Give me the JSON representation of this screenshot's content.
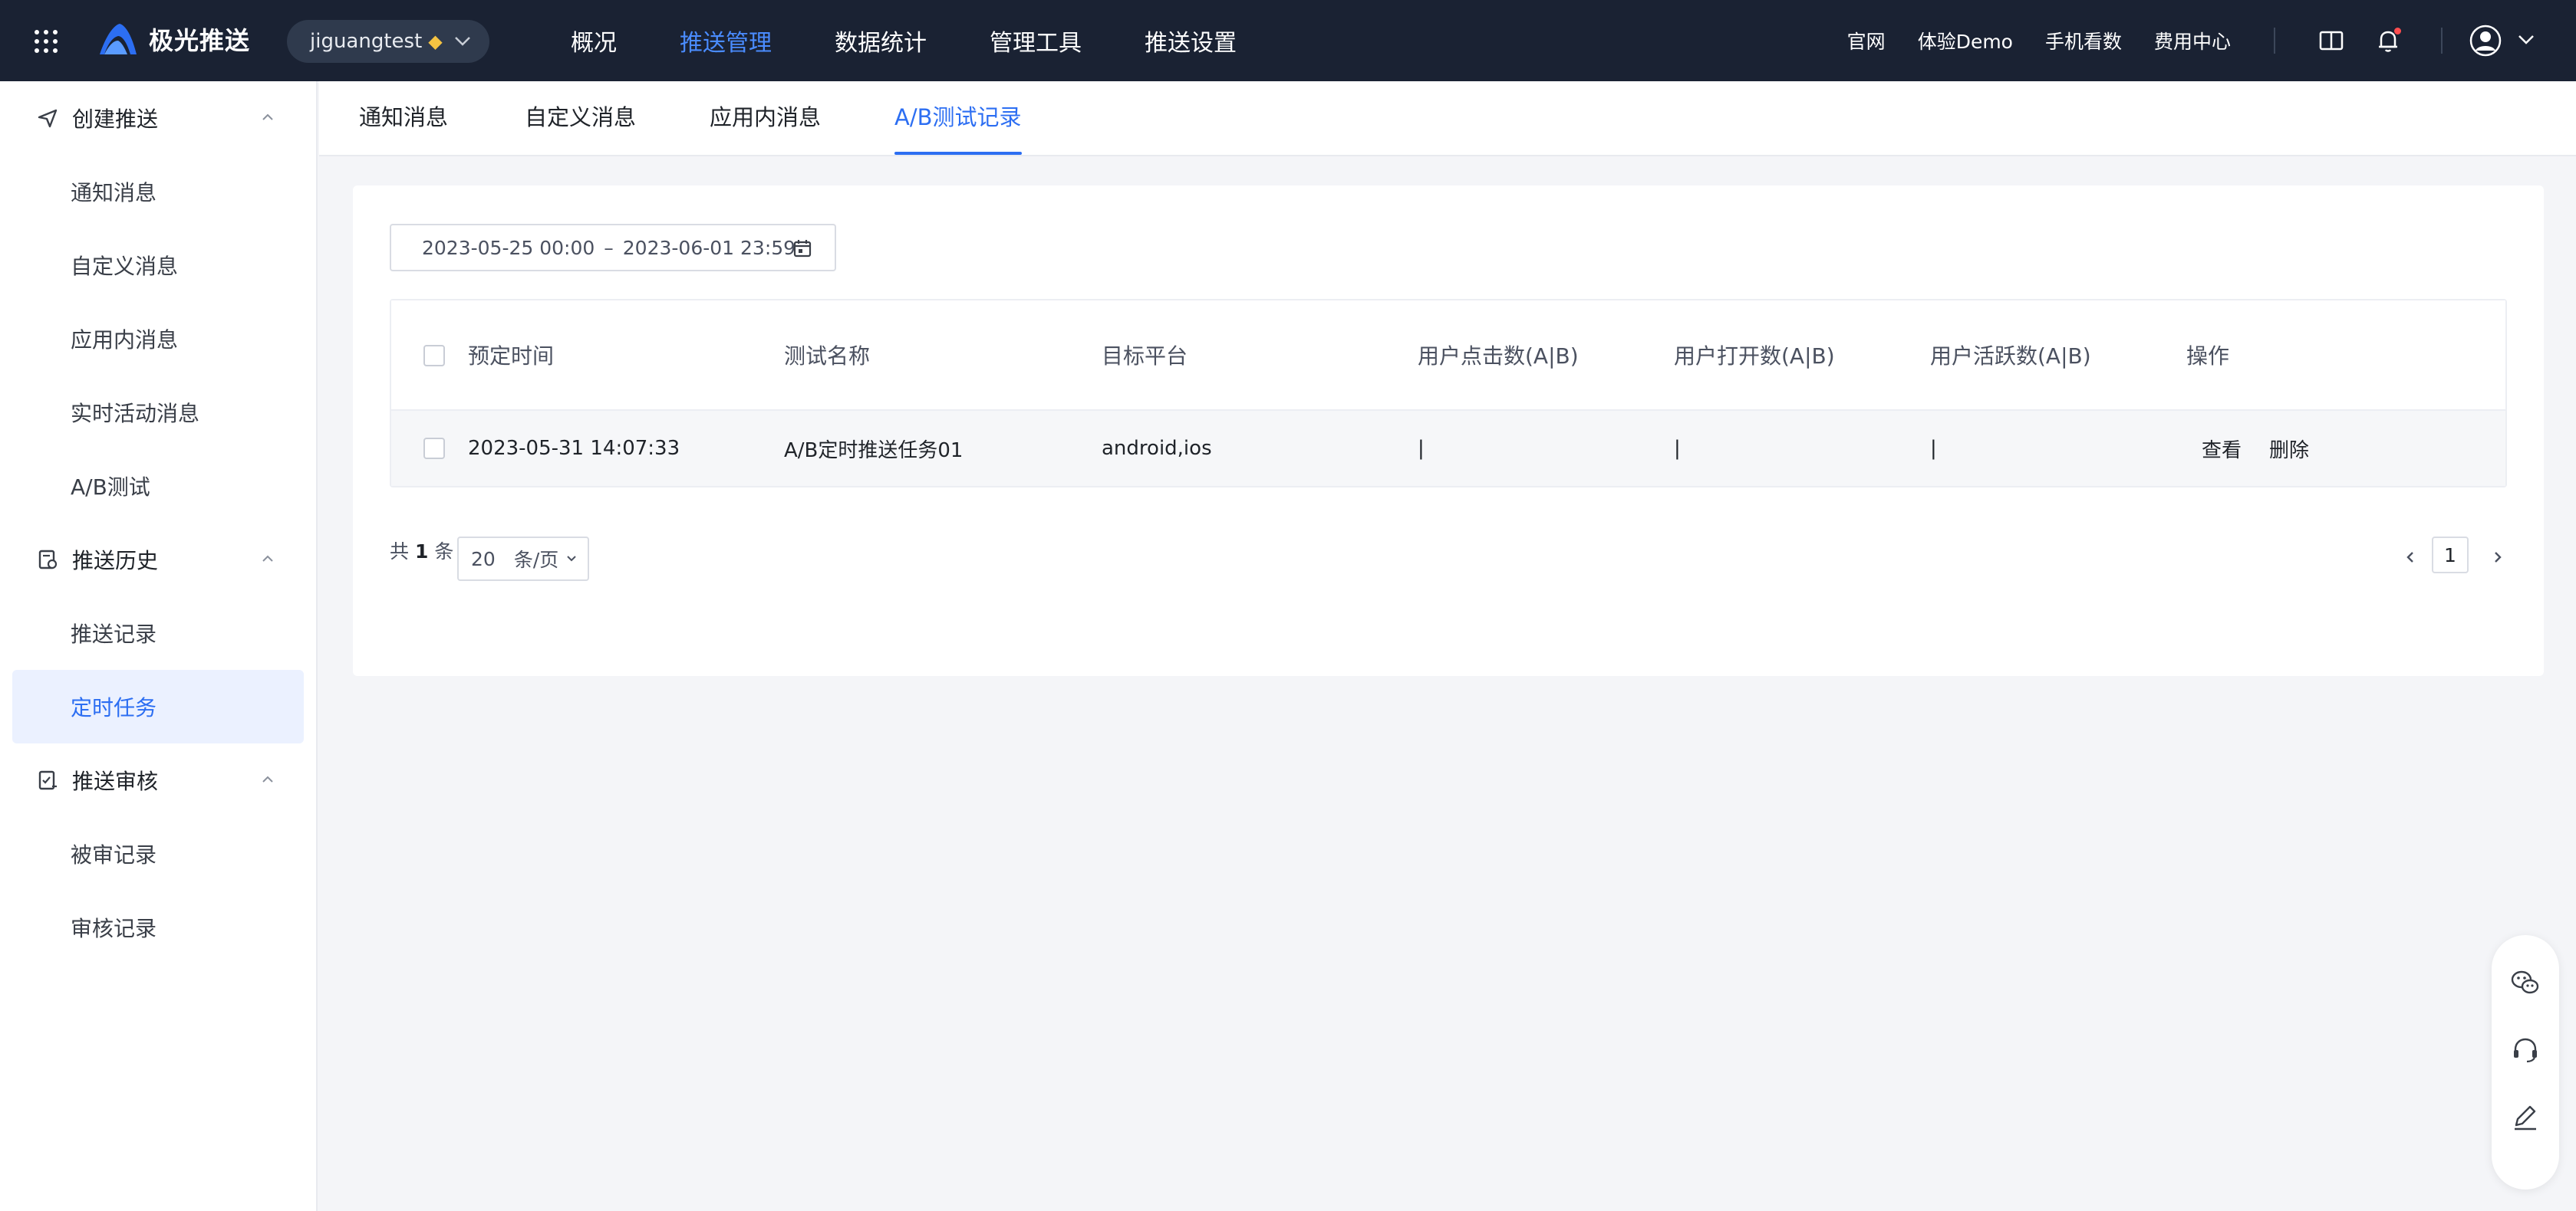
{
  "header": {
    "logo_text": "极光推送",
    "account": "jiguangtest",
    "nav": [
      "概况",
      "推送管理",
      "数据统计",
      "管理工具",
      "推送设置"
    ],
    "active_nav": "推送管理",
    "links": [
      "官网",
      "体验Demo",
      "手机看数",
      "费用中心"
    ],
    "accent_color": "#4a8cff",
    "bg_color": "#1a2233"
  },
  "sidebar": {
    "groups": [
      {
        "label": "创建推送",
        "icon": "send-icon",
        "items": [
          "通知消息",
          "自定义消息",
          "应用内消息",
          "实时活动消息",
          "A/B测试"
        ]
      },
      {
        "label": "推送历史",
        "icon": "history-icon",
        "items": [
          "推送记录",
          "定时任务"
        ]
      },
      {
        "label": "推送审核",
        "icon": "audit-icon",
        "items": [
          "被审记录",
          "审核记录"
        ]
      }
    ],
    "active_item": "定时任务"
  },
  "subtabs": [
    "通知消息",
    "自定义消息",
    "应用内消息",
    "A/B测试记录"
  ],
  "active_subtab": "A/B测试记录",
  "filter": {
    "date_start": "2023-05-25 00:00",
    "separator": "–",
    "date_end": "2023-06-01 23:59"
  },
  "table": {
    "columns": [
      "预定时间",
      "测试名称",
      "目标平台",
      "用户点击数(A|B)",
      "用户打开数(A|B)",
      "用户活跃数(A|B)",
      "操作"
    ],
    "rows": [
      {
        "time": "2023-05-31 14:07:33",
        "name": "A/B定时推送任务01",
        "platform": "android,ios",
        "clicks": "|",
        "opens": "|",
        "active": "|",
        "actions": [
          "查看",
          "删除"
        ]
      }
    ]
  },
  "pagination": {
    "total_prefix": "共",
    "total": "1",
    "total_suffix": "条",
    "page_size": "20",
    "page_size_unit": "条/页",
    "current_page": "1"
  },
  "float_tools": [
    "wechat-icon",
    "headset-icon",
    "edit-icon"
  ]
}
